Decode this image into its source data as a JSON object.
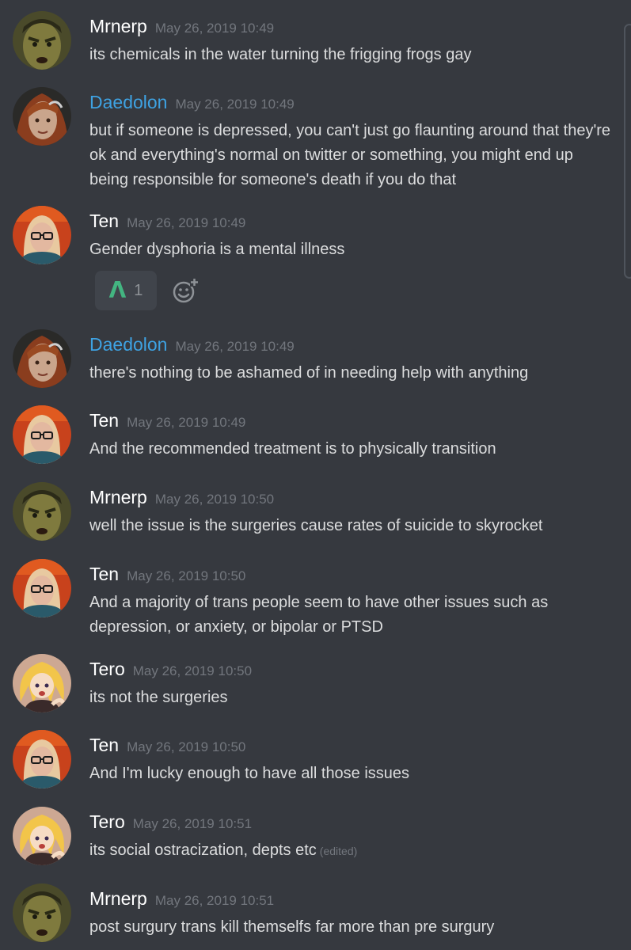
{
  "messages": [
    {
      "author": "Mrnerp",
      "timestamp": "May 26, 2019 10:49",
      "text": "its chemicals in the water turning the frigging frogs gay",
      "avatar": "mrnerp-avatar"
    },
    {
      "author": "Daedolon",
      "timestamp": "May 26, 2019 10:49",
      "text": "but if someone is depressed, you can't just go flaunting around that they're ok and everything's normal on twitter or something, you might end up being responsible for someone's death if you do that",
      "avatar": "daedolon-avatar",
      "name_color": "#3ea2e2"
    },
    {
      "author": "Ten",
      "timestamp": "May 26, 2019 10:49",
      "text": "Gender dysphoria is a mental illness",
      "avatar": "ten-avatar",
      "reaction": {
        "emoji": "Λ",
        "count": "1",
        "emoji_color": "#43b581",
        "icon": "up-arrow-emoji-icon"
      },
      "add_reaction_icon": "add-reaction-icon"
    },
    {
      "author": "Daedolon",
      "timestamp": "May 26, 2019 10:49",
      "text": "there's nothing to be ashamed of in needing help with anything",
      "avatar": "daedolon-avatar",
      "name_color": "#3ea2e2"
    },
    {
      "author": "Ten",
      "timestamp": "May 26, 2019 10:49",
      "text": "And the recommended treatment is to physically transition",
      "avatar": "ten-avatar"
    },
    {
      "author": "Mrnerp",
      "timestamp": "May 26, 2019 10:50",
      "text": "well the issue is the surgeries cause rates of suicide to skyrocket",
      "avatar": "mrnerp-avatar"
    },
    {
      "author": "Ten",
      "timestamp": "May 26, 2019 10:50",
      "text": "And a majority of trans people seem to have other issues such as depression, or anxiety, or bipolar or PTSD",
      "avatar": "ten-avatar"
    },
    {
      "author": "Tero",
      "timestamp": "May 26, 2019 10:50",
      "text": "its not the surgeries",
      "avatar": "tero-avatar"
    },
    {
      "author": "Ten",
      "timestamp": "May 26, 2019 10:50",
      "text": "And I'm lucky enough to have all those issues",
      "avatar": "ten-avatar"
    },
    {
      "author": "Tero",
      "timestamp": "May 26, 2019 10:51",
      "text": "its social  ostracization, depts etc",
      "edited": "(edited)",
      "avatar": "tero-avatar"
    },
    {
      "author": "Mrnerp",
      "timestamp": "May 26, 2019 10:51",
      "text": "post surgury trans kill themselfs far more than pre surgury",
      "avatar": "mrnerp-avatar"
    }
  ],
  "colors": {
    "background": "#36393f",
    "username_default": "#ffffff",
    "username_blue": "#3ea2e2",
    "timestamp": "#72767d",
    "message_text": "#dcddde"
  }
}
